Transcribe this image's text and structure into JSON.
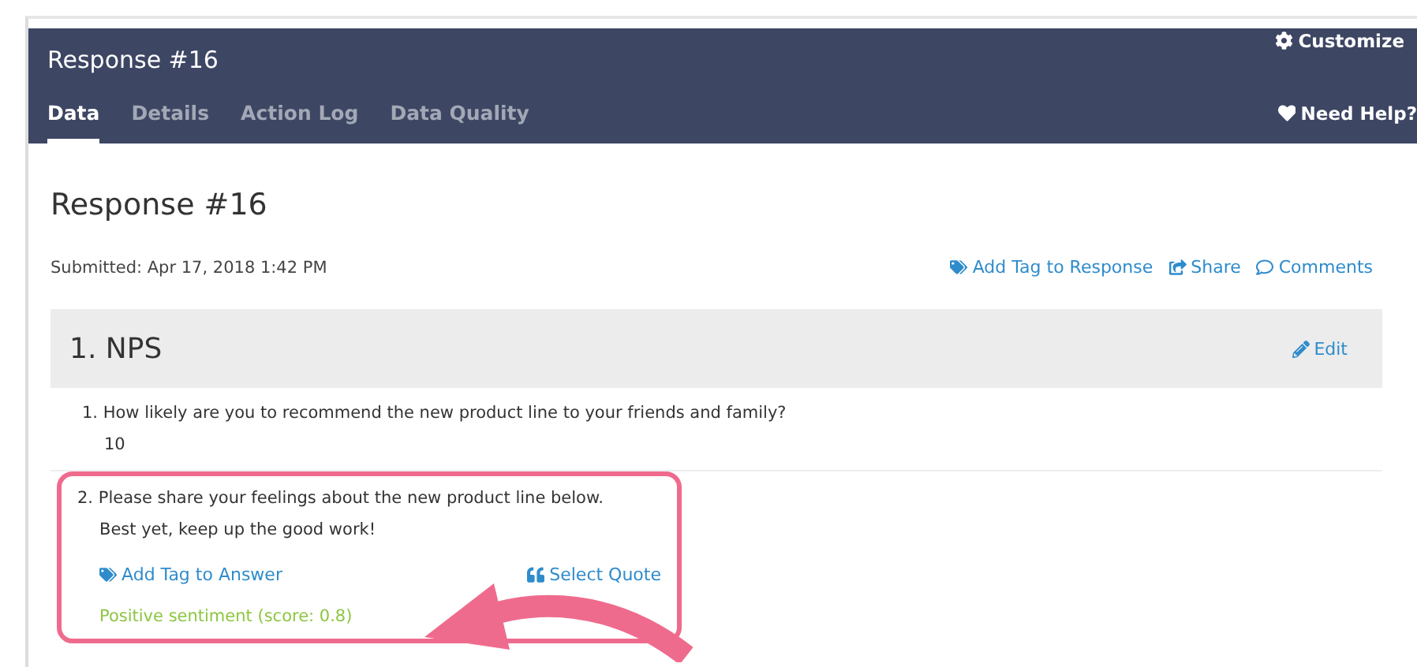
{
  "header": {
    "title": "Response #16",
    "customize": "Customize",
    "help": "Need Help?"
  },
  "tabs": [
    {
      "label": "Data",
      "selected": true
    },
    {
      "label": "Details",
      "selected": false
    },
    {
      "label": "Action Log",
      "selected": false
    },
    {
      "label": "Data Quality",
      "selected": false
    }
  ],
  "page": {
    "title": "Response #16",
    "submitted": "Submitted: Apr 17, 2018 1:42 PM",
    "actions": [
      "Add Tag to Response",
      "Share",
      "Comments"
    ]
  },
  "section": {
    "title": "1. NPS",
    "edit": "Edit"
  },
  "questions": [
    {
      "question": "1. How likely are you to recommend  the new product line to your friends and family?",
      "answer": "10",
      "highlighted": false
    },
    {
      "question": "2. Please share your feelings about the new product line below.",
      "answer": "Best yet, keep up the good work!",
      "highlighted": true,
      "add_tag": "Add Tag to Answer",
      "select_quote": "Select Quote",
      "sentiment": "Positive sentiment (score: 0.8)"
    }
  ]
}
